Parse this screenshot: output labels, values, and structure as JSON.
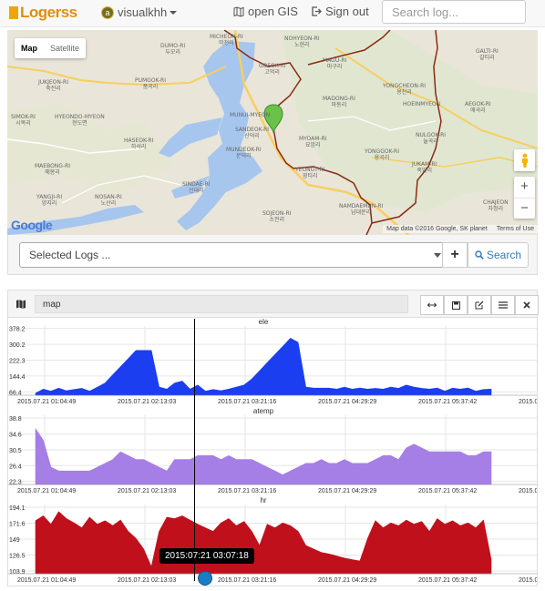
{
  "navbar": {
    "brand": "Logerss",
    "user": "visualkhh",
    "user_avatar_letter": "a",
    "gis_label": "open GIS",
    "signout_label": "Sign out",
    "search_placeholder": "Search log..."
  },
  "map": {
    "type_buttons": [
      "Map",
      "Satellite"
    ],
    "labels": [
      {
        "name": "MICHEON-RI",
        "ko": "미천리"
      },
      {
        "name": "NOHYEON-RI",
        "ko": "노현리"
      },
      {
        "name": "DUMO-RI",
        "ko": "두모리"
      },
      {
        "name": "GOEOK-RI",
        "ko": "고억리"
      },
      {
        "name": "MAGU-RI",
        "ko": "마구리"
      },
      {
        "name": "GALTI-RI",
        "ko": "갈티리"
      },
      {
        "name": "JUKJEON-RI",
        "ko": "죽전리"
      },
      {
        "name": "PUMGOK-RI",
        "ko": "품곡리"
      },
      {
        "name": "YONGCHEON-RI",
        "ko": "용천리"
      },
      {
        "name": "MADONG-RI",
        "ko": "마동리"
      },
      {
        "name": "SIMOK-RI",
        "ko": "시목리"
      },
      {
        "name": "HYEONDO-MYEON",
        "ko": "현도면"
      },
      {
        "name": "MUNUI-MYEON",
        "ko": ""
      },
      {
        "name": "HOEINMYEON",
        "ko": ""
      },
      {
        "name": "AEGOK-RI",
        "ko": "애곡리"
      },
      {
        "name": "HASEOK-RI",
        "ko": "하석리"
      },
      {
        "name": "SANDEOK-RI",
        "ko": "산덕리"
      },
      {
        "name": "MYOAM-RI",
        "ko": "묘암리"
      },
      {
        "name": "NULGOK-RI",
        "ko": "눌곡리"
      },
      {
        "name": "YONGGOK-RI",
        "ko": "용곡리"
      },
      {
        "name": "MAEBONG-RI",
        "ko": "매봉리"
      },
      {
        "name": "YEONGT-RI",
        "ko": "영티리"
      },
      {
        "name": "JUKAM-RI",
        "ko": "죽암리"
      },
      {
        "name": "SINDAE-RI",
        "ko": "신대리"
      },
      {
        "name": "MUNDEOK-RI",
        "ko": "문덕리"
      },
      {
        "name": "YANGJI-RI",
        "ko": "양지리"
      },
      {
        "name": "NOSAN-RI",
        "ko": "노산리"
      },
      {
        "name": "CHAJEON",
        "ko": "차정리"
      },
      {
        "name": "SOJEON-RI",
        "ko": "소전리"
      },
      {
        "name": "NAMDAEMUN-RI",
        "ko": "남대문리"
      }
    ],
    "google": "Google",
    "attribution": "Map data ©2016 Google, SK planet",
    "terms": "Terms of Use",
    "zoom_in": "+",
    "zoom_out": "−"
  },
  "selector": {
    "placeholder": "Selected Logs ...",
    "add_label": "+",
    "search_label": "Search"
  },
  "panel": {
    "title": "map"
  },
  "chart_data": [
    {
      "type": "area",
      "title": "ele",
      "yticks": [
        66.4,
        144.4,
        222.3,
        300.2,
        378.2
      ],
      "ylim": [
        50,
        390
      ],
      "x_ticks": [
        "2015.07.21 01:04:49",
        "2015.07.21 02:13:03",
        "2015.07.21 03:21:16",
        "2015.07.21 04:29:29",
        "2015.07.21 05:37:42",
        "2015.07"
      ],
      "color": "#1a3ef0",
      "values": [
        60,
        80,
        70,
        85,
        72,
        78,
        84,
        70,
        90,
        110,
        150,
        190,
        230,
        270,
        270,
        270,
        90,
        80,
        110,
        120,
        80,
        100,
        70,
        78,
        72,
        80,
        90,
        100,
        130,
        170,
        210,
        250,
        290,
        330,
        310,
        90,
        85,
        85,
        85,
        80,
        90,
        80,
        86,
        80,
        84,
        80,
        90,
        84,
        100,
        90,
        84,
        80,
        86,
        70,
        85,
        80,
        86,
        70,
        78,
        80
      ]
    },
    {
      "type": "area",
      "title": "atemp",
      "yticks": [
        22.3,
        26.4,
        30.5,
        34.6,
        38.8
      ],
      "ylim": [
        21.5,
        39.5
      ],
      "x_ticks": [
        "2015.07.21 01:04:49",
        "2015.07.21 02:13:03",
        "2015.07.21 03:21:16",
        "2015.07.21 04:29:29",
        "2015.07.21 05:37:42",
        "2015.07"
      ],
      "color": "#a57ee6",
      "values": [
        36,
        33,
        26,
        25,
        25,
        25,
        25,
        25,
        26,
        27,
        28,
        30,
        29,
        28,
        28,
        27,
        26,
        25,
        28,
        28,
        28,
        29,
        29,
        29,
        28,
        29,
        28,
        28,
        28,
        27,
        26,
        25,
        24,
        25,
        26,
        27,
        27,
        28,
        27,
        27,
        28,
        27,
        27,
        27,
        28,
        29,
        29,
        28,
        31,
        32,
        31,
        30,
        30,
        30,
        30,
        30,
        29,
        29,
        30,
        30
      ]
    },
    {
      "type": "area",
      "title": "hr",
      "yticks": [
        103.9,
        126.5,
        149.0,
        171.6,
        194.1
      ],
      "ylim": [
        100,
        198
      ],
      "x_ticks": [
        "2015.07.21 01:04:49",
        "2015.07.21 02:13:03",
        "2015.07.21 03:21:16",
        "2015.07.21 04:29:29",
        "2015.07.21 05:37:42",
        "2015.07"
      ],
      "color": "#c0101c",
      "values": [
        175,
        182,
        170,
        188,
        178,
        172,
        165,
        180,
        170,
        175,
        168,
        176,
        160,
        150,
        135,
        110,
        160,
        180,
        178,
        182,
        176,
        170,
        165,
        160,
        172,
        178,
        168,
        174,
        160,
        140,
        170,
        165,
        172,
        168,
        160,
        140,
        135,
        130,
        128,
        125,
        122,
        120,
        118,
        150,
        175,
        165,
        172,
        168,
        176,
        170,
        174,
        160,
        178,
        170,
        175,
        168,
        172,
        165,
        176,
        120
      ]
    }
  ],
  "tooltip": "2015:07:21 03:07:18"
}
